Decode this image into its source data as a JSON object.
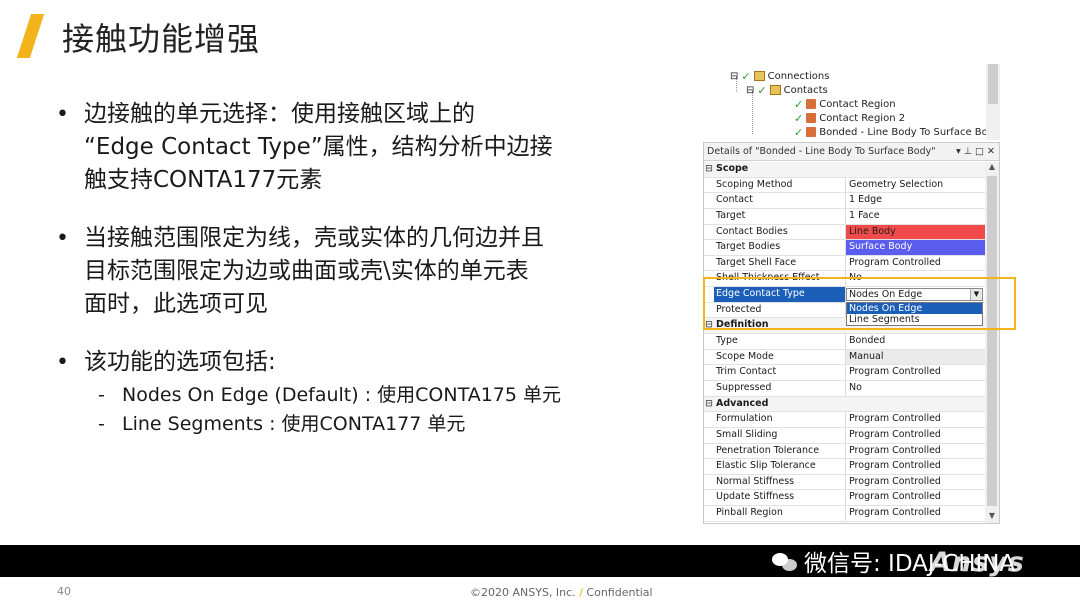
{
  "slide": {
    "title": "接触功能增强",
    "bullets": [
      "边接触的单元选择：使用接触区域上的\n“Edge Contact Type”属性，结构分析中边接\n触支持CONTA177元素",
      "当接触范围限定为线，壳或实体的几何边并且\n目标范围限定为边或曲面或壳\\实体的单元表\n面时，此选项可见",
      "该功能的选项包括:"
    ],
    "sub_items": [
      "Nodes On Edge (Default) : 使用CONTA175 单元",
      "Line Segments : 使用CONTA177 单元"
    ],
    "bullet_glyph": "•",
    "dash_glyph": "-"
  },
  "tree": {
    "connections": "Connections",
    "contacts": "Contacts",
    "region1": "Contact Region",
    "region2": "Contact Region 2",
    "bonded": "Bonded - Line Body To Surface Body"
  },
  "details": {
    "header": "Details of \"Bonded - Line Body To Surface Body\"",
    "controls": "▾ ⊥ □ ✕",
    "scope": {
      "label": "Scope",
      "rows": [
        {
          "k": "Scoping Method",
          "v": "Geometry Selection"
        },
        {
          "k": "Contact",
          "v": "1 Edge"
        },
        {
          "k": "Target",
          "v": "1 Face"
        },
        {
          "k": "Contact Bodies",
          "v": "Line Body"
        },
        {
          "k": "Target Bodies",
          "v": "Surface Body"
        },
        {
          "k": "Target Shell Face",
          "v": "Program Controlled"
        },
        {
          "k": "Shell Thickness Effect",
          "v": "No"
        },
        {
          "k": "Edge Contact Type",
          "v": "Nodes On Edge"
        },
        {
          "k": "Protected",
          "v": ""
        }
      ]
    },
    "definition": {
      "label": "Definition",
      "rows": [
        {
          "k": "Type",
          "v": "Bonded"
        },
        {
          "k": "Scope Mode",
          "v": "Manual"
        },
        {
          "k": "Trim Contact",
          "v": "Program Controlled"
        },
        {
          "k": "Suppressed",
          "v": "No"
        }
      ]
    },
    "advanced": {
      "label": "Advanced",
      "rows": [
        {
          "k": "Formulation",
          "v": "Program Controlled"
        },
        {
          "k": "Small Sliding",
          "v": "Program Controlled"
        },
        {
          "k": "Penetration Tolerance",
          "v": "Program Controlled"
        },
        {
          "k": "Elastic Slip Tolerance",
          "v": "Program Controlled"
        },
        {
          "k": "Normal Stiffness",
          "v": "Program Controlled"
        },
        {
          "k": "Update Stiffness",
          "v": "Program Controlled"
        },
        {
          "k": "Pinball Region",
          "v": "Program Controlled"
        }
      ]
    },
    "dropdown_options": [
      "Nodes On Edge",
      "Line Segments"
    ]
  },
  "footer": {
    "watermark": "微信号: IDAJ-CHINA",
    "brand": "Ansys",
    "page_number": "40",
    "copyright": "©2020 ANSYS, Inc.",
    "slash": "/",
    "confidential": "Confidential"
  },
  "colors": {
    "accent": "#f3b31a",
    "line_body": "#f14a4a",
    "surface_body": "#5b5cf0",
    "selection": "#1c5fb8"
  }
}
